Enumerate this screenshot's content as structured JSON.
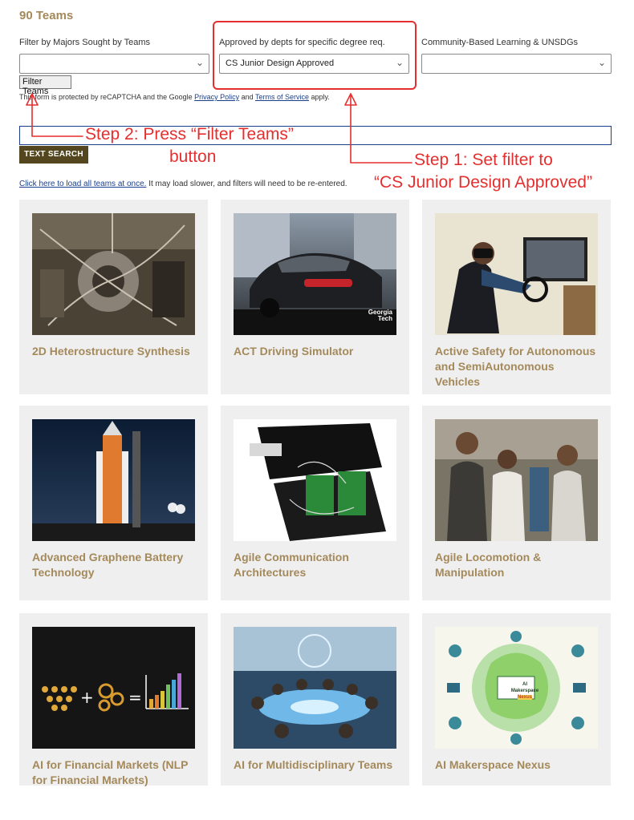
{
  "header": {
    "count": "90 Teams"
  },
  "filters": [
    {
      "label": "Filter by Majors Sought by Teams",
      "value": ""
    },
    {
      "label": "Approved by depts for specific degree req.",
      "value": "CS Junior Design Approved"
    },
    {
      "label": "Community-Based Learning & UNSDGs",
      "value": ""
    }
  ],
  "filter_button": "Filter Teams",
  "recaptcha": {
    "prefix": "This form is protected by reCAPTCHA and the Google ",
    "privacy": "Privacy Policy",
    "and": " and ",
    "terms": "Terms of Service",
    "suffix": " apply."
  },
  "text_search": {
    "value": "",
    "button": "TEXT SEARCH"
  },
  "load_all": {
    "link": "Click here to load all teams at once.",
    "rest": " It may load slower, and filters will need to be re-entered."
  },
  "annotations": {
    "step2_line1": "Step 2: Press “Filter Teams”",
    "step2_line2": "button",
    "step1_line1": "Step 1: Set filter to",
    "step1_line2": "“CS Junior Design Approved”",
    "color": "#e52e2e"
  },
  "teams": [
    {
      "title": "2D Heterostructure Synthesis"
    },
    {
      "title": "ACT Driving Simulator",
      "logo": "Georgia Tech"
    },
    {
      "title": "Active Safety for Autonomous and SemiAutonomous Vehicles"
    },
    {
      "title": "Advanced Graphene Battery Technology"
    },
    {
      "title": "Agile Communication Architectures"
    },
    {
      "title": "Agile Locomotion & Manipulation"
    },
    {
      "title": "AI for Financial Markets (NLP for Financial Markets)"
    },
    {
      "title": "AI for Multidisciplinary Teams"
    },
    {
      "title": "AI Makerspace Nexus",
      "logo": "AI Makerspace Nexus"
    }
  ],
  "colors": {
    "gold": "#a4895a",
    "navy": "#1a3f8a",
    "button_dark": "#54471f",
    "card_bg": "#efefef"
  }
}
